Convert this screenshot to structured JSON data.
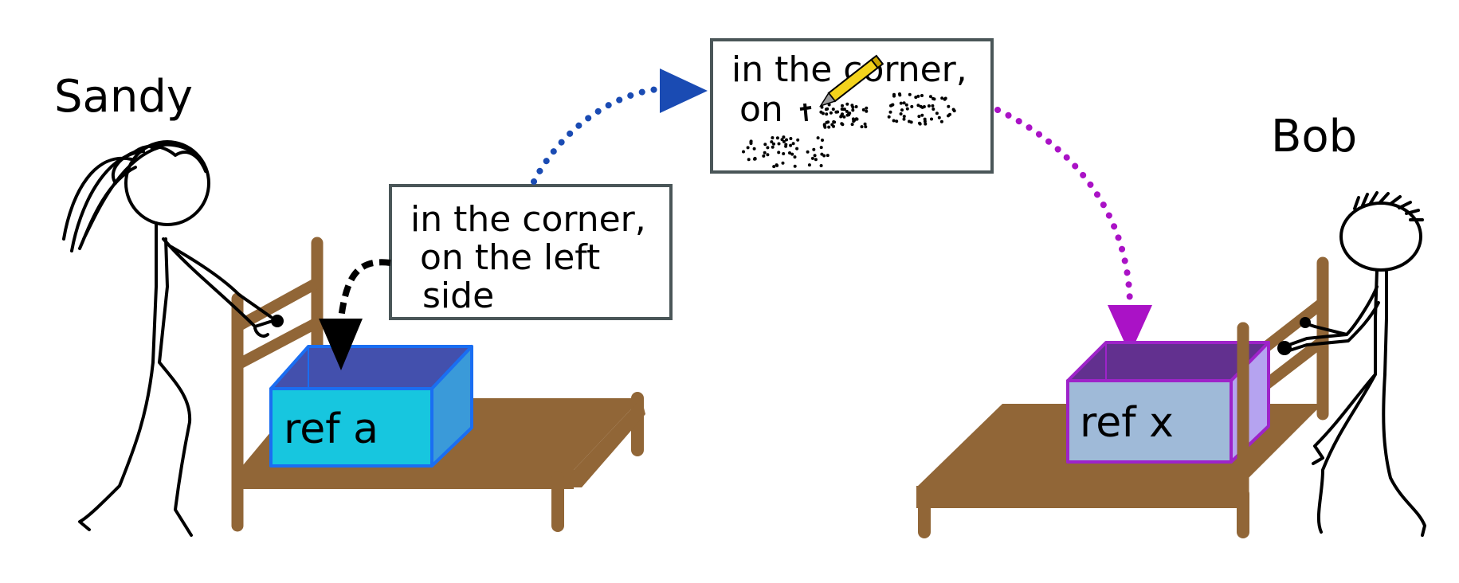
{
  "people": {
    "left_name": "Sandy",
    "right_name": "Bob"
  },
  "note_original": {
    "line1": "in the corner,",
    "line2": "on the left",
    "line3": "side"
  },
  "note_transit": {
    "line1": "in the corner,",
    "line2": "on"
  },
  "boxes": {
    "left_label": "ref a",
    "right_label": "ref x"
  },
  "colors": {
    "wood": "#916637",
    "left_box_front": "#17c6df",
    "left_box_top": "#4350ad",
    "left_box_border": "#1a6ef2",
    "right_box_front": "#9fbad8",
    "right_box_top": "#62308f",
    "right_box_border": "#9e23c9",
    "blue_path": "#1a4bb3",
    "purple_path": "#aa12c6",
    "note_border": "#4a5658",
    "pencil": "#f3d31c"
  },
  "icons": {
    "pencil": "pencil-icon",
    "eraser_marks": "smudge-dots"
  }
}
